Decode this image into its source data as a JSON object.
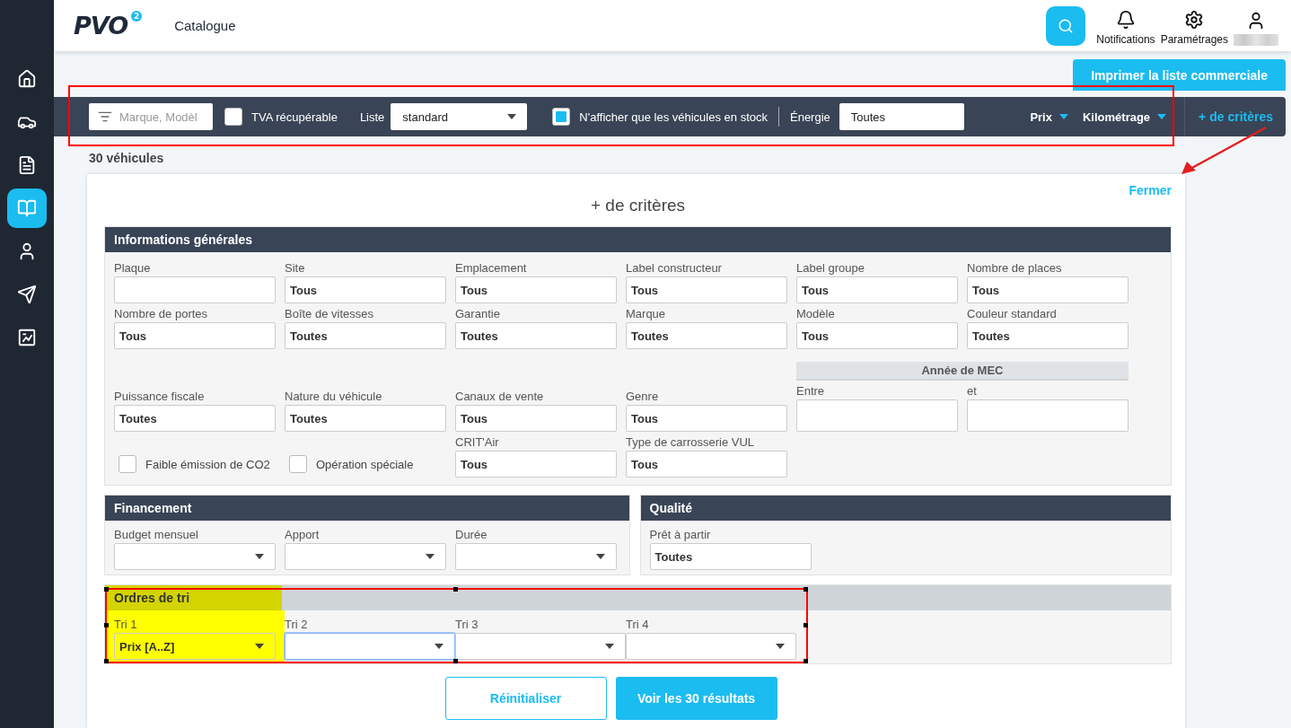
{
  "sidebar": {
    "items": [
      {
        "selected": false
      },
      {
        "selected": false
      },
      {
        "selected": false
      },
      {
        "selected": true
      },
      {
        "selected": false
      },
      {
        "selected": false
      },
      {
        "selected": false
      }
    ]
  },
  "header": {
    "logo": "PVO",
    "logo_badge": "2",
    "title": "Catalogue",
    "actions": [
      {
        "label": "Notifications"
      },
      {
        "label": "Paramétrages"
      }
    ]
  },
  "print_button": "Imprimer la liste commerciale",
  "filter_bar": {
    "search_placeholder": "Marque, Modèl",
    "vat": {
      "label": "TVA récupérable",
      "checked": false
    },
    "list": {
      "label": "Liste",
      "value": "standard"
    },
    "stock": {
      "label": "N'afficher que les véhicules en stock",
      "checked": true
    },
    "energy": {
      "label": "Énergie",
      "value": "Toutes"
    },
    "sorts": [
      "Prix",
      "Kilométrage"
    ],
    "more_link": "+ de critères"
  },
  "count": "30 véhicules",
  "criteria_panel": {
    "title": "+ de critères",
    "close_link": "Fermer",
    "general": {
      "title": "Informations générales",
      "rows": [
        [
          {
            "kind": "field",
            "label": "Plaque"
          },
          {
            "kind": "field",
            "label": "Site",
            "value": "Tous"
          },
          {
            "kind": "field",
            "label": "Emplacement",
            "value": "Tous"
          },
          {
            "kind": "field",
            "label": "Label constructeur",
            "value": "Tous"
          },
          {
            "kind": "field",
            "label": "Label groupe",
            "value": "Tous"
          },
          {
            "kind": "field",
            "label": "Nombre de places",
            "value": "Tous"
          }
        ],
        [
          {
            "kind": "field",
            "label": "Nombre de portes",
            "value": "Tous"
          },
          {
            "kind": "field",
            "label": "Boîte de vitesses",
            "value": "Toutes"
          },
          {
            "kind": "field",
            "label": "Garantie",
            "value": "Toutes"
          },
          {
            "kind": "field",
            "label": "Marque",
            "value": "Toutes"
          },
          {
            "kind": "field",
            "label": "Modèle",
            "value": "Tous"
          },
          {
            "kind": "field",
            "label": "Couleur standard",
            "value": "Toutes"
          }
        ],
        [
          {
            "kind": "field",
            "label": "Puissance fiscale",
            "value": "Toutes"
          },
          {
            "kind": "field",
            "label": "Nature du véhicule",
            "value": "Toutes"
          },
          {
            "kind": "field",
            "label": "Canaux de vente",
            "value": "Tous"
          },
          {
            "kind": "field",
            "label": "Genre",
            "value": "Tous"
          },
          {
            "kind": "range",
            "title": "Année de MEC",
            "from_label": "Entre",
            "to_label": "et"
          }
        ],
        [
          {
            "kind": "checkbox",
            "label": "Faible émission de CO2",
            "checked": false
          },
          {
            "kind": "checkbox",
            "label": "Opération spéciale",
            "checked": false
          },
          {
            "kind": "field",
            "label": "CRIT'Air",
            "value": "Tous"
          },
          {
            "kind": "field",
            "label": "Type de carrosserie VUL",
            "value": "Tous"
          }
        ]
      ]
    },
    "financing": {
      "title": "Financement",
      "selects": [
        {
          "label": "Budget mensuel"
        },
        {
          "label": "Apport"
        },
        {
          "label": "Durée"
        }
      ]
    },
    "quality": {
      "title": "Qualité",
      "fields": [
        {
          "label": "Prêt à partir",
          "value": "Toutes"
        }
      ]
    },
    "sort_orders": {
      "title": "Ordres de tri",
      "title_highlighted": true,
      "selects": [
        {
          "label": "Tri 1",
          "value": "Prix [A..Z]",
          "highlighted": true,
          "focused": false
        },
        {
          "label": "Tri 2",
          "highlighted": false,
          "focused": true
        },
        {
          "label": "Tri 3",
          "highlighted": false,
          "focused": false
        },
        {
          "label": "Tri 4",
          "highlighted": false,
          "focused": false
        }
      ]
    },
    "buttons": {
      "reset": "Réinitialiser",
      "submit": "Voir les 30 résultats"
    }
  },
  "annotations": [
    {
      "kind": "frame"
    },
    {
      "kind": "selection"
    },
    {
      "kind": "arrow"
    }
  ]
}
